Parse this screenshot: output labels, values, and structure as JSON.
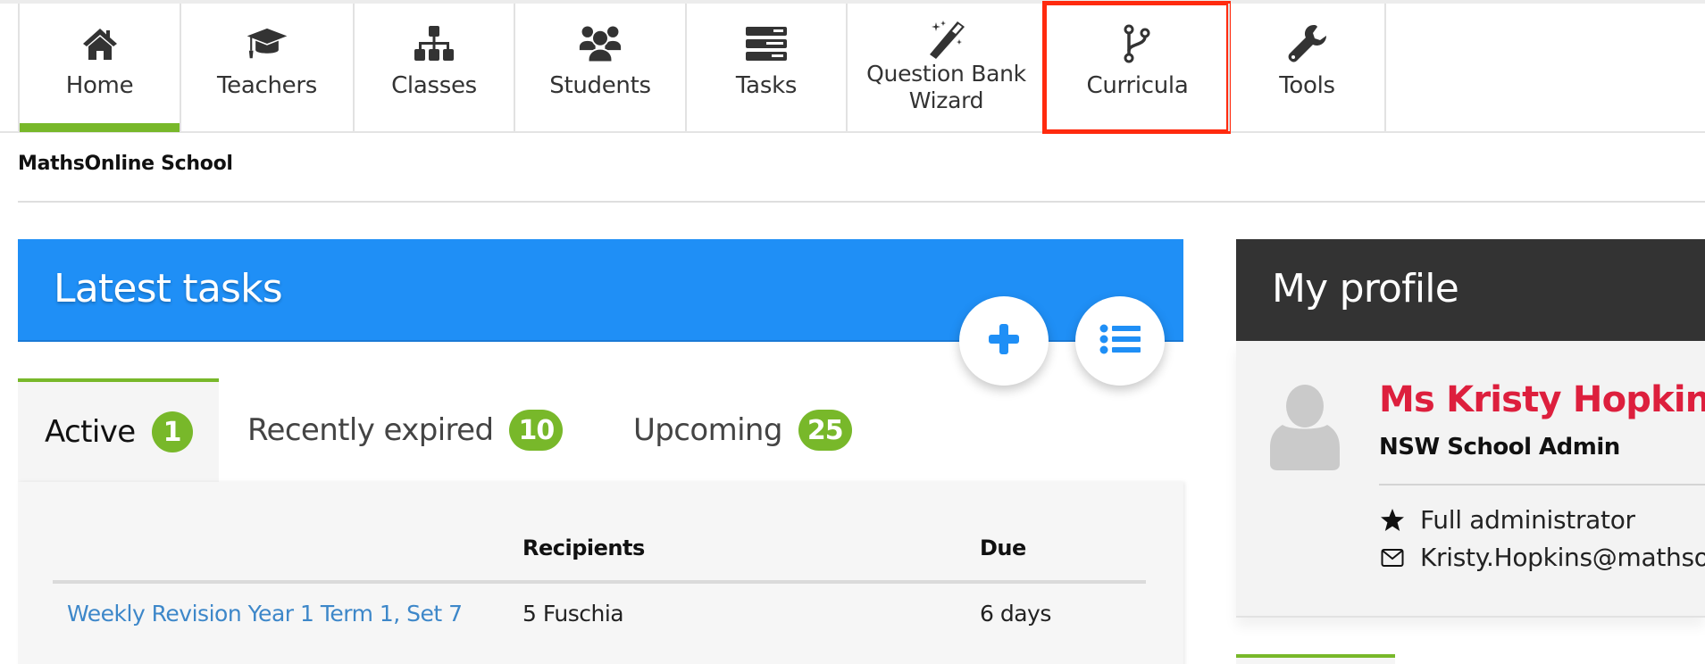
{
  "nav": {
    "tabs": [
      {
        "label": "Home",
        "icon": "home-icon",
        "active": true
      },
      {
        "label": "Teachers",
        "icon": "graduation-cap-icon"
      },
      {
        "label": "Classes",
        "icon": "sitemap-icon"
      },
      {
        "label": "Students",
        "icon": "users-icon"
      },
      {
        "label": "Tasks",
        "icon": "tasks-icon"
      },
      {
        "label": "Question Bank Wizard",
        "label_line1": "Question Bank",
        "label_line2": "Wizard",
        "icon": "magic-wand-icon"
      },
      {
        "label": "Curricula",
        "icon": "code-branch-icon",
        "highlighted": true
      },
      {
        "label": "Tools",
        "icon": "wrench-icon"
      }
    ]
  },
  "school_name": "MathsOnline School",
  "latest_tasks": {
    "title": "Latest tasks",
    "add_button_icon": "plus-icon",
    "list_button_icon": "list-icon",
    "tabs": [
      {
        "label": "Active",
        "count": "1",
        "active": true
      },
      {
        "label": "Recently expired",
        "count": "10"
      },
      {
        "label": "Upcoming",
        "count": "25"
      }
    ],
    "table": {
      "columns": [
        "",
        "Recipients",
        "Due"
      ],
      "rows": [
        {
          "name": "Weekly Revision Year 1 Term 1, Set 7",
          "recipients": "5 Fuschia",
          "due": "6 days"
        }
      ]
    }
  },
  "profile": {
    "title": "My profile",
    "name": "Ms Kristy Hopkins",
    "role": "NSW School Admin",
    "permission": "Full administrator",
    "email": "Kristy.Hopkins@mathsonline.com.au"
  },
  "colors": {
    "accent_green": "#78b82a",
    "header_blue": "#1f8ff6",
    "profile_dark": "#333333",
    "name_red": "#dd1f3d",
    "link_blue": "#3d87c9",
    "highlight_red": "#ff2a0e"
  }
}
